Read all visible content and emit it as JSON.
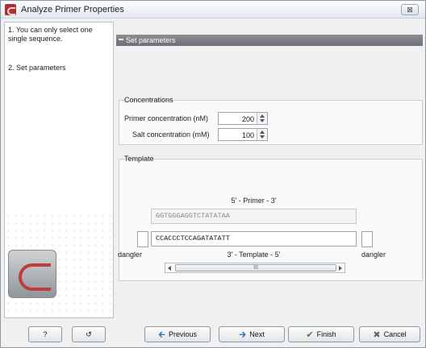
{
  "window": {
    "title": "Analyze Primer Properties",
    "close_glyph": "⊠"
  },
  "steps": [
    {
      "label": "1. You can only select one single sequence."
    },
    {
      "label": "2. Set parameters"
    }
  ],
  "main": {
    "section_title": "Set parameters",
    "concentrations": {
      "group_title": "Concentrations",
      "primer_label": "Primer concentration (nM)",
      "primer_value": "200",
      "salt_label": "Salt concentration (mM)",
      "salt_value": "100"
    },
    "template": {
      "group_title": "Template",
      "primer_direction": "5' - Primer - 3'",
      "primer_sequence": "GGTGGGAGGTCTATATAA",
      "template_sequence": "CCACCCTCCAGATATATT",
      "template_direction": "3' - Template - 5'",
      "dangler_left": "dangler",
      "dangler_right": "dangler",
      "scroll_grip": "III"
    }
  },
  "footer": {
    "help_label": "?",
    "reset_glyph": "↺",
    "previous_label": "Previous",
    "next_label": "Next",
    "finish_label": "Finish",
    "cancel_label": "Cancel"
  },
  "icons": {
    "previous": "arrow-left-icon",
    "next": "arrow-right-icon",
    "finish": "checkmark-icon",
    "cancel": "x-icon"
  }
}
